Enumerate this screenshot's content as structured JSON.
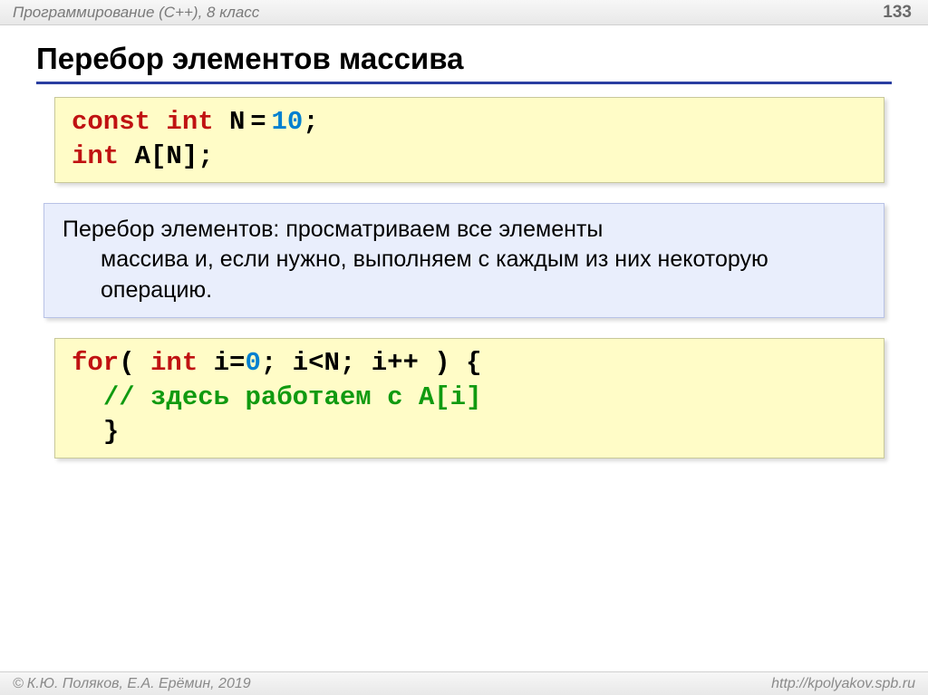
{
  "header": {
    "subject": "Программирование (C++), 8 класс",
    "page": "133"
  },
  "title": "Перебор элементов массива",
  "code1": {
    "l1": {
      "kw1": "const",
      "kw2": "int",
      "var": " N",
      "eq": " = ",
      "num": "10",
      "semi": ";"
    },
    "l2": {
      "kw": "int",
      "rest": " A[N];"
    }
  },
  "definition": {
    "term": "Перебор элементов",
    "colon": ": ",
    "body1": "просматриваем все элементы ",
    "body2": "массива и, если нужно, выполняем с каждым из них некоторую операцию."
  },
  "code2": {
    "l1": {
      "kw1": "for",
      "p1": "( ",
      "kw2": "int",
      "p2": " i=",
      "num": "0",
      "p3": "; i<N; i++ ) {"
    },
    "l2": {
      "indent": "  ",
      "comment": "// здесь работаем с A[i]"
    },
    "l3": {
      "indent": "  ",
      "brace": "}"
    }
  },
  "footer": {
    "copyright": "К.Ю. Поляков, Е.А. Ерёмин, 2019",
    "url": "http://kpolyakov.spb.ru"
  }
}
